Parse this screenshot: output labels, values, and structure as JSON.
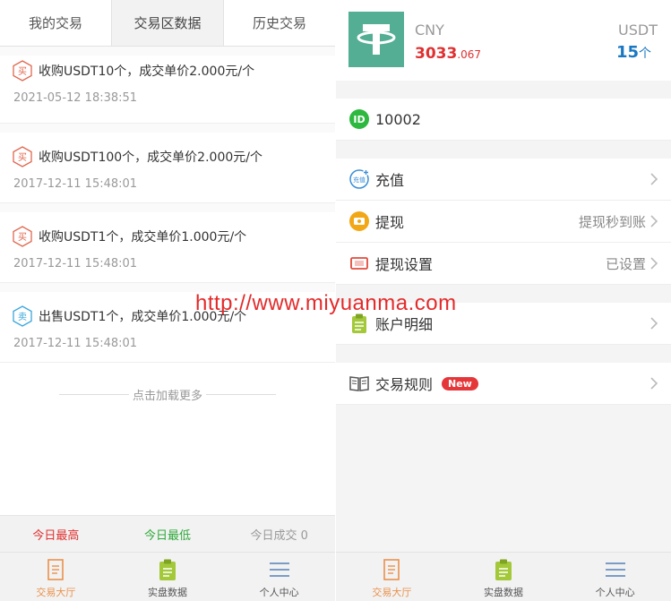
{
  "left": {
    "tabs": [
      "我的交易",
      "交易区数据",
      "历史交易"
    ],
    "records": [
      {
        "type": "买",
        "text": "收购USDT10个，成交单价2.000元/个",
        "time": "2021-05-12 18:38:51"
      },
      {
        "type": "买",
        "text": "收购USDT100个，成交单价2.000元/个",
        "time": "2017-12-11 15:48:01"
      },
      {
        "type": "买",
        "text": "收购USDT1个，成交单价1.000元/个",
        "time": "2017-12-11 15:48:01"
      },
      {
        "type": "卖",
        "text": "出售USDT1个，成交单价1.000元/个",
        "time": "2017-12-11 15:48:01"
      }
    ],
    "load_more": "点击加载更多",
    "stats": {
      "high": "今日最高",
      "low": "今日最低",
      "volume": "今日成交 0"
    }
  },
  "tabbar": {
    "items": [
      "交易大厅",
      "实盘数据",
      "个人中心"
    ]
  },
  "right": {
    "wallet": {
      "cny_label": "CNY",
      "cny_int": "3033",
      "cny_dec": ".067",
      "usdt_label": "USDT",
      "usdt_num": "15",
      "usdt_unit": "个"
    },
    "user_id": "10002",
    "menu": {
      "recharge": "充值",
      "recharge_icon_text": "充值",
      "withdraw": "提现",
      "withdraw_hint": "提现秒到账",
      "withdraw_settings": "提现设置",
      "withdraw_settings_hint": "已设置",
      "account_details": "账户明细",
      "trade_rules": "交易规则",
      "new_badge": "New"
    }
  },
  "watermark": "http://www.miyuanma.com",
  "colors": {
    "buy": "#e0664e",
    "sell": "#38a6dd",
    "red": "#e03030",
    "green": "#2eaa3a",
    "orange": "#e9914c",
    "tether": "#53ae94",
    "blue": "#1a78c2"
  }
}
